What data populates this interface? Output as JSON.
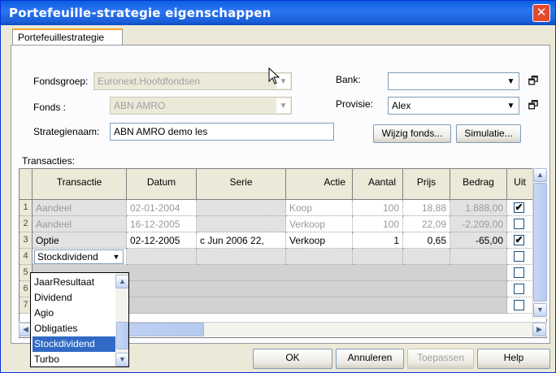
{
  "window": {
    "title": "Portefeuille-strategie eigenschappen",
    "close_glyph": "✕"
  },
  "tab": {
    "label": "Portefeuillestrategie"
  },
  "form": {
    "fondsgroep_label": "Fondsgroep:",
    "fondsgroep_value": "Euronext.Hoofdfondsen",
    "fonds_label": "Fonds :",
    "fonds_value": "ABN AMRO",
    "strategienaam_label": "Strategienaam:",
    "strategienaam_value": "ABN AMRO demo les",
    "bank_label": "Bank:",
    "bank_value": "",
    "provisie_label": "Provisie:",
    "provisie_value": "Alex",
    "wijzig_button": "Wijzig fonds...",
    "simulatie_button": "Simulatie..."
  },
  "transacties": {
    "label": "Transacties:",
    "columns": [
      "Transactie",
      "Datum",
      "Serie",
      "Actie",
      "Aantal",
      "Prijs",
      "Bedrag",
      "Uit"
    ],
    "rows": [
      {
        "num": "1",
        "transactie": "Aandeel",
        "datum": "02-01-2004",
        "serie": "",
        "actie": "Koop",
        "aantal": "100",
        "prijs": "18,88",
        "bedrag": "1.888,00",
        "uit": "✔"
      },
      {
        "num": "2",
        "transactie": "Aandeel",
        "datum": "16-12-2005",
        "serie": "",
        "actie": "Verkoop",
        "aantal": "100",
        "prijs": "22,09",
        "bedrag": "-2.209,00",
        "uit": ""
      },
      {
        "num": "3",
        "transactie": "Optie",
        "datum": "02-12-2005",
        "serie": "c Jun 2006 22,",
        "actie": "Verkoop",
        "aantal": "1",
        "prijs": "0,65",
        "bedrag": "-65,00",
        "uit": "✔"
      },
      {
        "num": "4",
        "transactie": "Stockdividend",
        "datum": "",
        "serie": "",
        "actie": "",
        "aantal": "",
        "prijs": "",
        "bedrag": "",
        "uit": ""
      },
      {
        "num": "5",
        "transactie": "",
        "uit": ""
      },
      {
        "num": "6",
        "transactie": "",
        "uit": ""
      },
      {
        "num": "7",
        "transactie": "",
        "uit": ""
      }
    ],
    "dropdown_options": [
      "JaarResultaat",
      "Dividend",
      "Agio",
      "Obligaties",
      "Stockdividend",
      "Turbo"
    ],
    "dropdown_selected": "Stockdividend"
  },
  "footer": {
    "ok": "OK",
    "annuleren": "Annuleren",
    "toepassen": "Toepassen",
    "help": "Help"
  },
  "colors": {
    "titlebar": "#0a5fe0",
    "selection": "#316ac5",
    "tab_accent": "#f5a623"
  }
}
